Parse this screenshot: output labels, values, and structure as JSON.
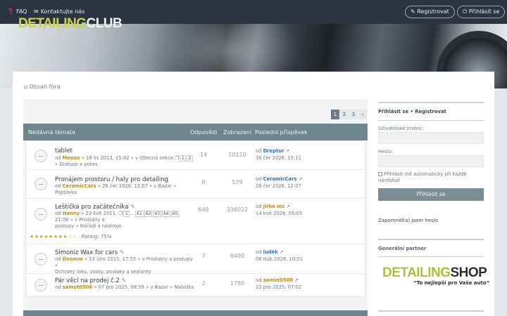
{
  "topbar": {
    "faq": "FAQ",
    "contact": "Kontaktujte nás",
    "register": "Registrovat",
    "login": "Přihlásit se"
  },
  "logo": {
    "part1": "DETAILING",
    "part2": "CLUB"
  },
  "breadcrumb": "Obsah fóra",
  "pagination": [
    "1",
    "2",
    "3",
    "›"
  ],
  "table": {
    "col_topics": "Nedávná témata",
    "col_replies": "Odpovědi",
    "col_views": "Zobrazení",
    "col_last": "Poslední příspěvek"
  },
  "topics": [
    {
      "title": "tablet",
      "meta1_pre": "od ",
      "author": "Mouse",
      "meta1_post": " » 18 lis 2013, 15:42 » v Obecná sekce",
      "meta2": "» Diskuse a pokec",
      "pages": [
        "1",
        "2"
      ],
      "replies": "14",
      "views": "10110",
      "last_pre": "od ",
      "last_author": "Dreptur",
      "last_author_color": "#2a6fd6",
      "last_date": "30 čer 2026, 15:11"
    },
    {
      "title": "Pronájem prostoru / haly pro detailing",
      "meta1_pre": "od ",
      "author": "CeramicCars",
      "meta1_post": " » 26 čer 2026, 12:07 » v Bazar »",
      "meta2": "Poptávka",
      "replies": "0",
      "views": "579",
      "last_pre": "od ",
      "last_author": "CeramicCars",
      "last_author_color": "#2a6fd6",
      "last_date": "26 čer 2026, 12:07"
    },
    {
      "title": "Leštička pro začátečníka",
      "meta1_pre": "od ",
      "author": "Hanny",
      "meta1_post": " » 23 kvě 2011,",
      "meta2": "21:06 » v Produkty a",
      "meta3": "postupy » Nářadí a nástroje",
      "pages": [
        "1",
        "…",
        "61",
        "62",
        "63",
        "64",
        "65"
      ],
      "rating": "Rating: 75%",
      "replies": "648",
      "views": "336022",
      "last_pre": "od ",
      "last_author": "jirka mz",
      "last_author_color": "#c28a14",
      "last_date": "14 kvě 2026, 05:05"
    },
    {
      "title": "Simoniz Wax for cars",
      "meta1_pre": "od ",
      "author": "Doomm",
      "meta1_post": " » 13 úno 2015, 17:55 » v Produkty a postupy »",
      "meta2": "Ochrany laku, vosky, povlaky a sealanty",
      "replies": "7",
      "views": "6490",
      "last_pre": "od ",
      "last_author": "ludék",
      "last_author_color": "#2a6fd6",
      "last_date": "08 dub 2026, 10:51"
    },
    {
      "title": "Pár věcí na prodej č.2",
      "meta1_pre": "od ",
      "author": "samot0506",
      "meta1_post": " » 07 pro 2025, 08:59 » v Bazar » Nabídka",
      "replies": "2",
      "views": "1780",
      "last_pre": "od ",
      "last_author": "samot0506",
      "last_author_color": "#c28a14",
      "last_date": "12 pro 2025, 07:02"
    }
  ],
  "sidebar": {
    "login_link": "Přihlásit se",
    "sep": "•",
    "register_link": "Registrovat",
    "username_label": "Uživatelské jméno:",
    "password_label": "Heslo:",
    "remember_label": "Přihlásit mě automaticky při každé návštěvě",
    "submit": "Přihlásit se",
    "forgot": "Zapomněl(a) jsem heslo",
    "partner_title": "Generální partner",
    "shop_part1": "DETAILING",
    "shop_part2": "SHOP",
    "slogan": "“To nejlepší pro Vaše auto”"
  }
}
